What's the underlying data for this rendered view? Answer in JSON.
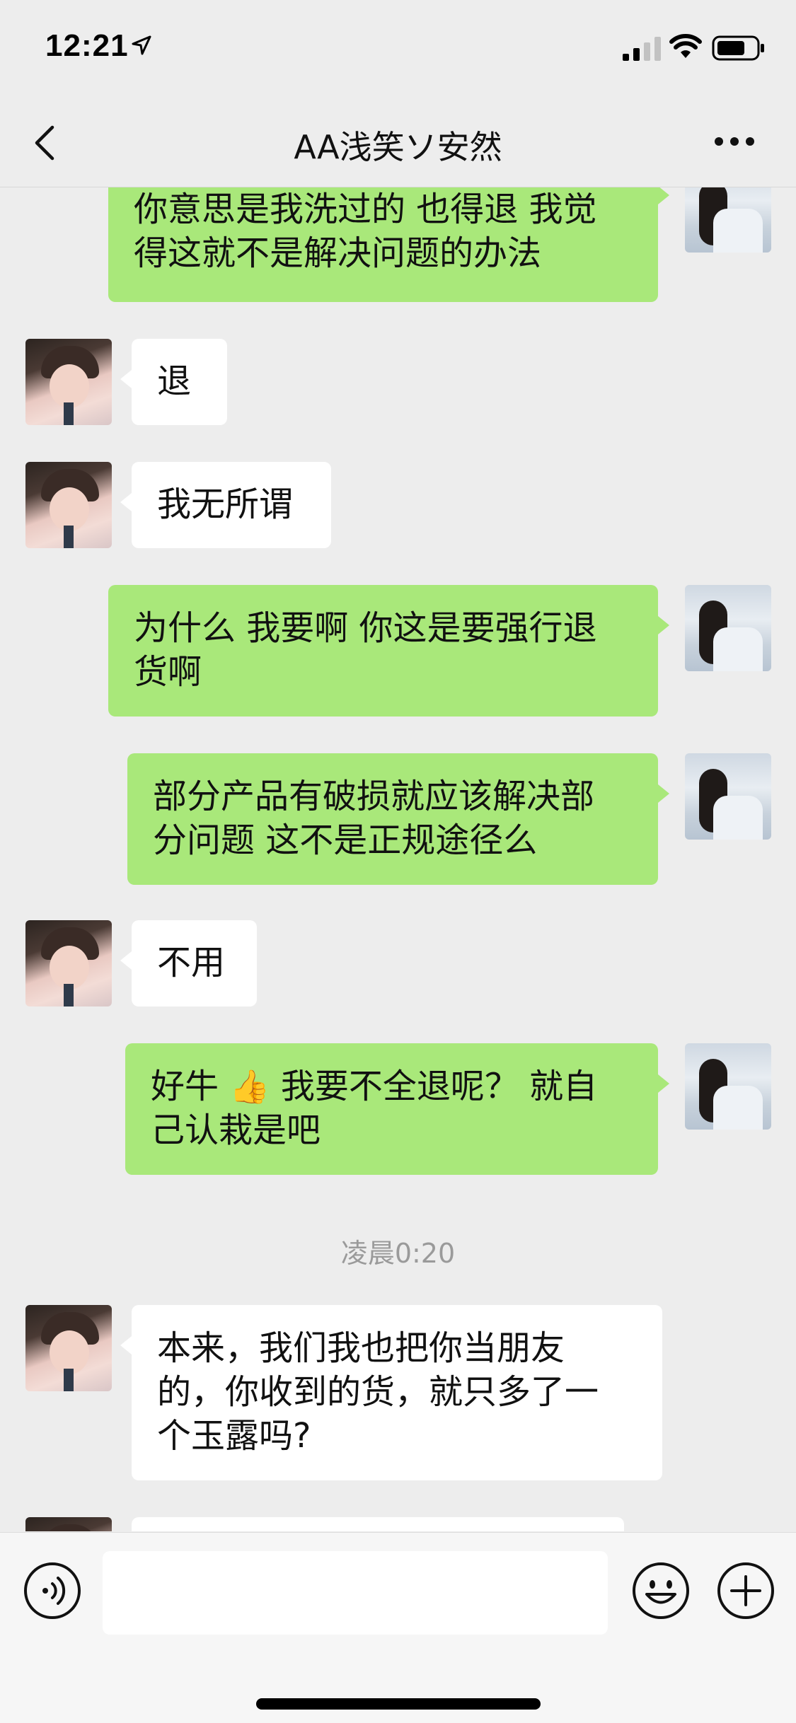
{
  "status": {
    "time": "12:21"
  },
  "header": {
    "title": "AA浅笑ソ安然"
  },
  "messages": [
    {
      "side": "right",
      "line1": "你意思是我洗过的 也得退 我觉",
      "line2": "得这就不是解决问题的办法"
    },
    {
      "side": "left",
      "text": "退"
    },
    {
      "side": "left",
      "text": "我无所谓"
    },
    {
      "side": "right",
      "line1": "为什么 我要啊 你这是要强行退",
      "line2": "货啊"
    },
    {
      "side": "right",
      "line1": "部分产品有破损就应该解决部",
      "line2": "分问题 这不是正规途径么"
    },
    {
      "side": "left",
      "text": "不用"
    },
    {
      "side": "right",
      "line1_a": "好牛",
      "line1_emoji": "👍",
      "line1_b": "我要不全退呢？ 就自",
      "line2": "己认栽是吧"
    },
    {
      "side": "left",
      "line1": "本来，我们我也把你当朋友",
      "line2": "的，你收到的货，就只多了一",
      "line3": "个玉露吗?"
    }
  ],
  "timestamp": "凌晨0:20",
  "input": {
    "value": "",
    "placeholder": ""
  },
  "icons": {
    "back": "chevron-left-icon",
    "more": "more-dots-icon",
    "voice": "voice-icon",
    "emoji": "emoji-icon",
    "plus": "plus-icon"
  },
  "colors": {
    "bubble_sent": "#a9e87a",
    "bubble_received": "#ffffff",
    "background": "#ededed"
  }
}
